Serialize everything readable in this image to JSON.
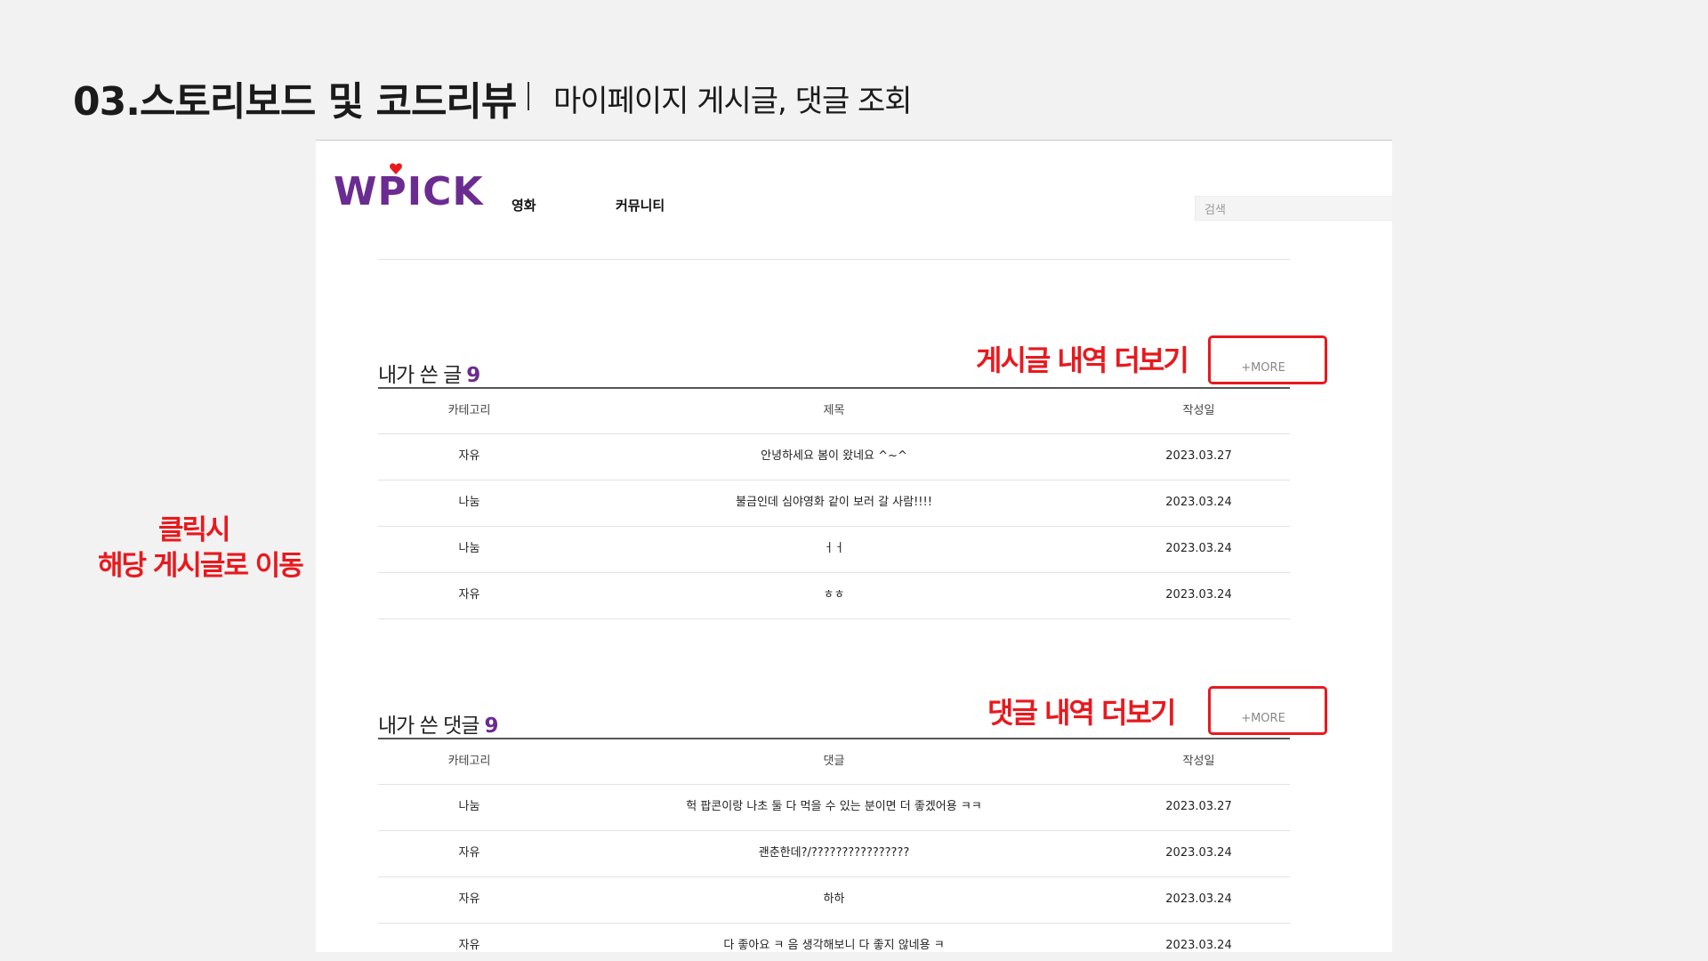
{
  "slide": {
    "title": "03.스토리보드 및 코드리뷰",
    "subtitle": "마이페이지 게시글, 댓글 조회"
  },
  "header": {
    "logo_text": "WPICK",
    "nav": [
      "영화",
      "커뮤니티"
    ],
    "search_placeholder": "검색"
  },
  "posts": {
    "title": "내가 쓴 글",
    "count": "9",
    "more_label": "+MORE",
    "columns": [
      "카테고리",
      "제목",
      "작성일"
    ],
    "rows": [
      {
        "category": "자유",
        "title": "안녕하세요 봄이 왔네요 ^~^",
        "date": "2023.03.27"
      },
      {
        "category": "나눔",
        "title": "불금인데 심야영화 같이 보러 갈 사람!!!!",
        "date": "2023.03.24"
      },
      {
        "category": "나눔",
        "title": "ㅓㅓ",
        "date": "2023.03.24"
      },
      {
        "category": "자유",
        "title": "ㅎㅎ",
        "date": "2023.03.24"
      }
    ]
  },
  "comments": {
    "title": "내가 쓴 댓글",
    "count": "9",
    "more_label": "+MORE",
    "columns": [
      "카테고리",
      "댓글",
      "작성일"
    ],
    "rows": [
      {
        "category": "나눔",
        "comment": "헉 팝콘이랑 나초 둘 다 먹을 수 있는 분이면 더 좋겠어용 ㅋㅋ",
        "date": "2023.03.27"
      },
      {
        "category": "자유",
        "comment": "괜춘한데?/????????????????",
        "date": "2023.03.24"
      },
      {
        "category": "자유",
        "comment": "하하",
        "date": "2023.03.24"
      },
      {
        "category": "자유",
        "comment": "다 좋아요 ㅋ 음 생각해보니 다 좋지 않네용 ㅋ",
        "date": "2023.03.24"
      }
    ]
  },
  "annotations": {
    "posts_more": "게시글 내역 더보기",
    "comments_more": "댓글 내역 더보기",
    "click_line1": "클릭시",
    "click_line2": "해당 게시글로 이동"
  },
  "colors": {
    "brand_purple": "#6b2c91",
    "heart_red": "#e8191e",
    "annotation_red": "#e8191e"
  }
}
